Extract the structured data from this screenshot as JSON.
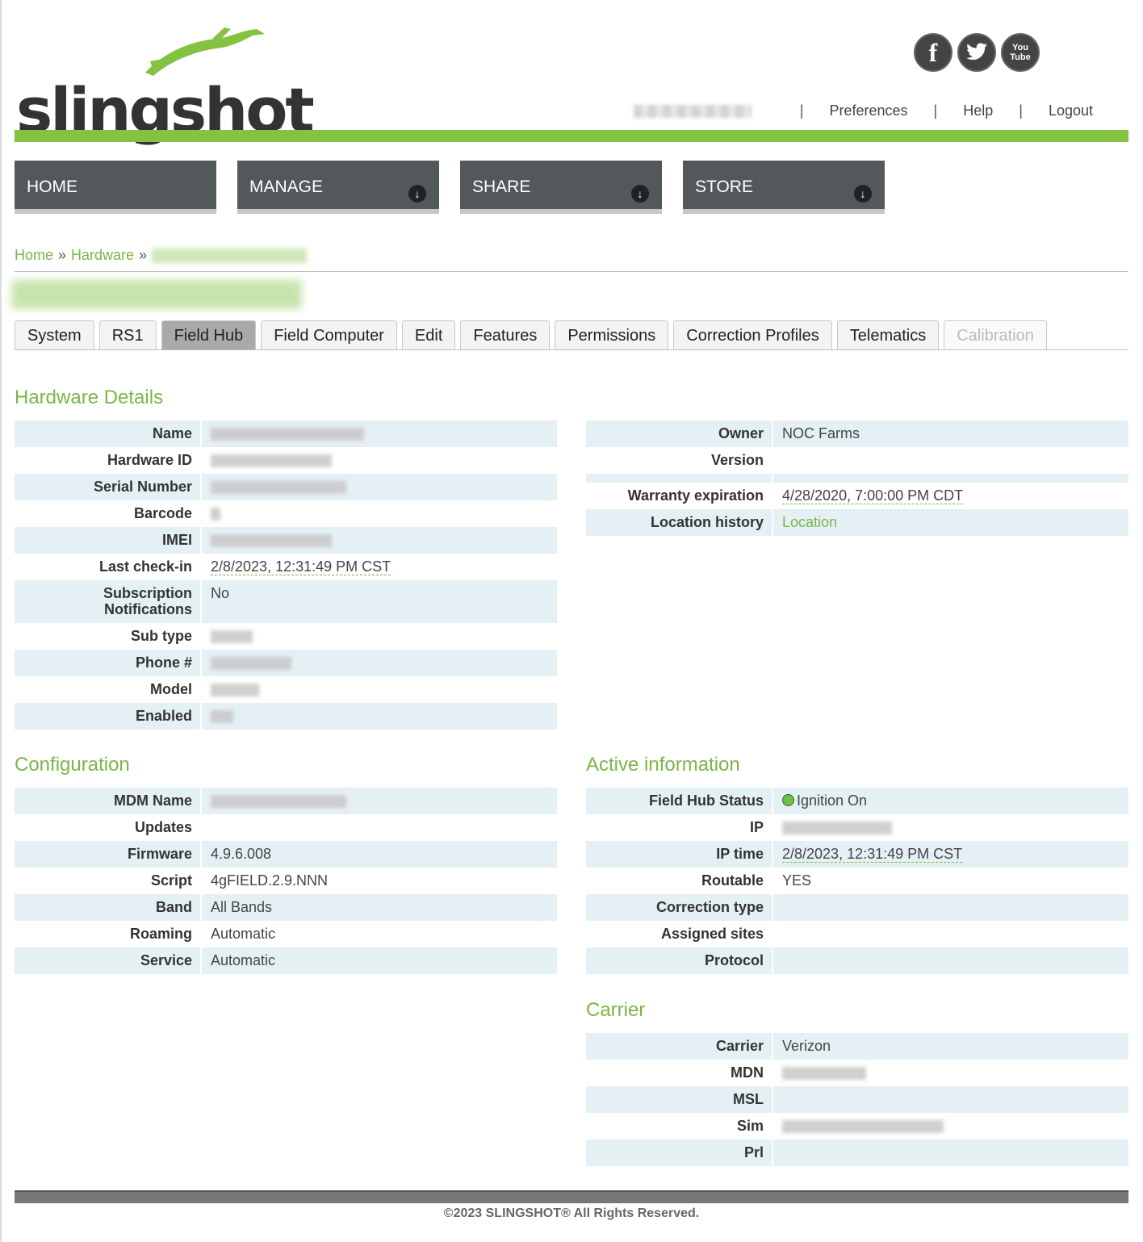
{
  "brand": {
    "name": "slingshot",
    "reg": "®"
  },
  "social": [
    {
      "icon": "facebook-icon",
      "label": "f"
    },
    {
      "icon": "twitter-icon",
      "label": ""
    },
    {
      "icon": "youtube-icon",
      "label": "You Tube"
    }
  ],
  "topnav": {
    "sep": "|",
    "preferences": "Preferences",
    "help": "Help",
    "logout": "Logout"
  },
  "mainnav": {
    "home": "HOME",
    "manage": "MANAGE",
    "share": "SHARE",
    "store": "STORE",
    "arrow": "↓"
  },
  "breadcrumb": {
    "home": "Home",
    "hardware": "Hardware",
    "sep": "»"
  },
  "tabs": [
    "System",
    "RS1",
    "Field Hub",
    "Field Computer",
    "Edit",
    "Features",
    "Permissions",
    "Correction Profiles",
    "Telematics",
    "Calibration"
  ],
  "hardware_details": {
    "title": "Hardware Details",
    "left": {
      "name": "Name",
      "hardware_id": "Hardware ID",
      "serial": "Serial Number",
      "barcode": "Barcode",
      "imei": "IMEI",
      "last_checkin": "Last check-in",
      "last_checkin_val": "2/8/2023, 12:31:49 PM CST",
      "sub_notif": "Subscription Notifications",
      "sub_notif_val": "No",
      "sub_type": "Sub type",
      "phone": "Phone #",
      "model": "Model",
      "enabled": "Enabled"
    },
    "right": {
      "owner": "Owner",
      "owner_val": "NOC Farms",
      "version": "Version",
      "warranty": "Warranty expiration",
      "warranty_val": "4/28/2020, 7:00:00 PM CDT",
      "location": "Location history",
      "location_val": "Location"
    }
  },
  "configuration": {
    "title": "Configuration",
    "mdm": "MDM Name",
    "updates": "Updates",
    "firmware": "Firmware",
    "firmware_val": "4.9.6.008",
    "script": "Script",
    "script_val": "4gFIELD.2.9.NNN",
    "band": "Band",
    "band_val": "All Bands",
    "roaming": "Roaming",
    "roaming_val": "Automatic",
    "service": "Service",
    "service_val": "Automatic"
  },
  "active": {
    "title": "Active information",
    "status": "Field Hub Status",
    "status_val": "Ignition On",
    "ip": "IP",
    "ip_time": "IP time",
    "ip_time_val": "2/8/2023, 12:31:49 PM CST",
    "routable": "Routable",
    "routable_val": "YES",
    "correction": "Correction type",
    "assigned": "Assigned sites",
    "protocol": "Protocol"
  },
  "carrier": {
    "title": "Carrier",
    "carrier": "Carrier",
    "carrier_val": "Verizon",
    "mdn": "MDN",
    "msl": "MSL",
    "sim": "Sim",
    "prl": "Prl"
  },
  "footer": "©2023 SLINGSHOT® All Rights Reserved."
}
